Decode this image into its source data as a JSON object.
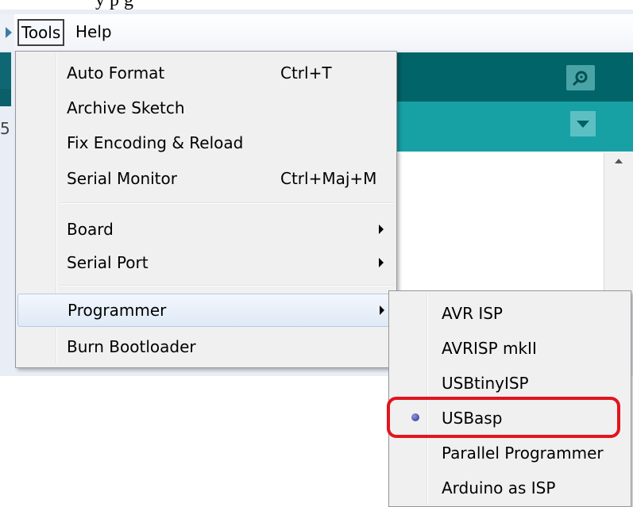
{
  "top_text": "y               p  g",
  "menubar": {
    "tools_label": "Tools",
    "help_label": "Help"
  },
  "left_fragment": "5",
  "tools_menu": {
    "items": [
      {
        "label": "Auto Format",
        "shortcut": "Ctrl+T"
      },
      {
        "label": "Archive Sketch",
        "shortcut": ""
      },
      {
        "label": "Fix Encoding & Reload",
        "shortcut": ""
      },
      {
        "label": "Serial Monitor",
        "shortcut": "Ctrl+Maj+M"
      },
      {
        "label": "Board",
        "shortcut": ""
      },
      {
        "label": "Serial Port",
        "shortcut": ""
      },
      {
        "label": "Programmer",
        "shortcut": ""
      },
      {
        "label": "Burn Bootloader",
        "shortcut": ""
      }
    ]
  },
  "programmer_submenu": {
    "items": [
      {
        "label": "AVR ISP"
      },
      {
        "label": "AVRISP mkII"
      },
      {
        "label": "USBtinyISP"
      },
      {
        "label": "USBasp"
      },
      {
        "label": "Parallel Programmer"
      },
      {
        "label": "Arduino as ISP"
      }
    ],
    "selected": "USBasp"
  },
  "icons": {
    "serial_monitor": "magnifier-icon",
    "tab_menu": "triangle-down-icon",
    "submenu_arrow": "triangle-right-icon",
    "radio": "radio-dot-icon"
  },
  "colors": {
    "toolbar": "#006468",
    "tabbar": "#17a1a5",
    "highlight_box": "#e3141e",
    "radio": "#2a2f8a"
  }
}
